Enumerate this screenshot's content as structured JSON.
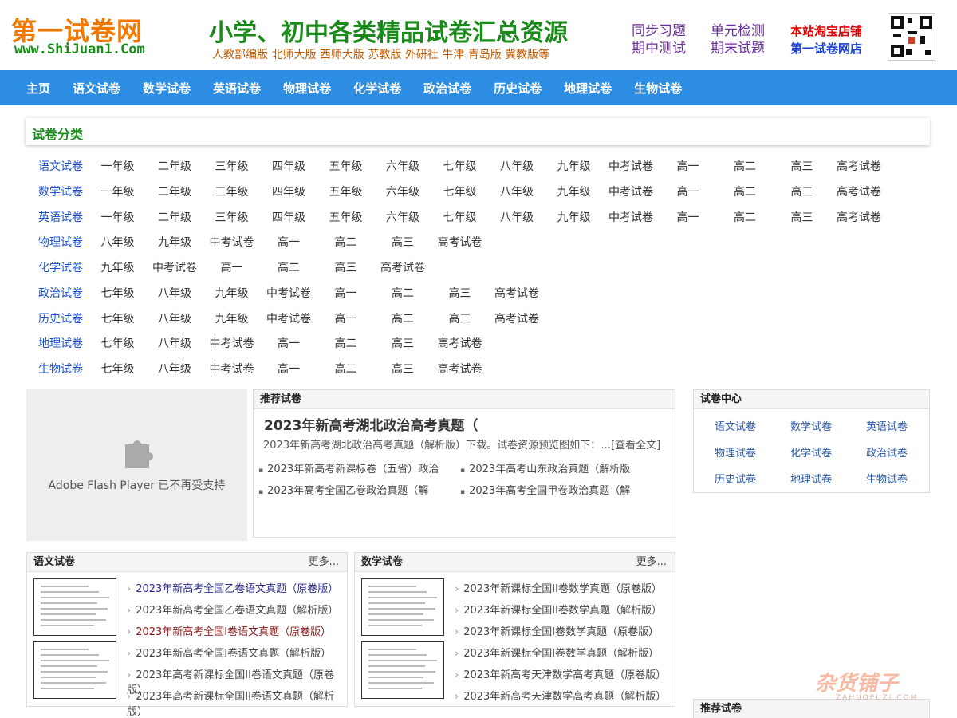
{
  "header": {
    "logo_cn": "第一试卷网",
    "logo_en": "www.ShiJuan1.Com",
    "slogan": "小学、初中各类精品试卷汇总资源",
    "editions": "人教部编版  北师大版  西师大版  苏教版  外研社  牛津  青岛版  冀教版等",
    "feature_1": "同步习题",
    "feature_2": "单元检测",
    "feature_3": "期中测试",
    "feature_4": "期末试题",
    "shop_1": "本站淘宝店铺",
    "shop_2": "第一试卷网店"
  },
  "nav": [
    "主页",
    "语文试卷",
    "数学试卷",
    "英语试卷",
    "物理试卷",
    "化学试卷",
    "政治试卷",
    "历史试卷",
    "地理试卷",
    "生物试卷"
  ],
  "category": {
    "title": "试卷分类",
    "rows": [
      [
        "语文试卷",
        "一年级",
        "二年级",
        "三年级",
        "四年级",
        "五年级",
        "六年级",
        "七年级",
        "八年级",
        "九年级",
        "中考试卷",
        "高一",
        "高二",
        "高三",
        "高考试卷"
      ],
      [
        "数学试卷",
        "一年级",
        "二年级",
        "三年级",
        "四年级",
        "五年级",
        "六年级",
        "七年级",
        "八年级",
        "九年级",
        "中考试卷",
        "高一",
        "高二",
        "高三",
        "高考试卷"
      ],
      [
        "英语试卷",
        "一年级",
        "二年级",
        "三年级",
        "四年级",
        "五年级",
        "六年级",
        "七年级",
        "八年级",
        "九年级",
        "中考试卷",
        "高一",
        "高二",
        "高三",
        "高考试卷"
      ],
      [
        "物理试卷",
        "八年级",
        "九年级",
        "中考试卷",
        "高一",
        "高二",
        "高三",
        "高考试卷"
      ],
      [
        "化学试卷",
        "九年级",
        "中考试卷",
        "高一",
        "高二",
        "高三",
        "高考试卷"
      ],
      [
        "政治试卷",
        "七年级",
        "八年级",
        "九年级",
        "中考试卷",
        "高一",
        "高二",
        "高三",
        "高考试卷"
      ],
      [
        "历史试卷",
        "七年级",
        "八年级",
        "九年级",
        "中考试卷",
        "高一",
        "高二",
        "高三",
        "高考试卷"
      ],
      [
        "地理试卷",
        "七年级",
        "八年级",
        "中考试卷",
        "高一",
        "高二",
        "高三",
        "高考试卷"
      ],
      [
        "生物试卷",
        "七年级",
        "八年级",
        "中考试卷",
        "高一",
        "高二",
        "高三",
        "高考试卷"
      ]
    ]
  },
  "flash": {
    "message": "Adobe Flash Player 已不再受支持"
  },
  "recommended": {
    "header": "推荐试卷",
    "title": "2023年新高考湖北政治高考真题（",
    "desc": "2023年新高考湖北政治高考真题（解析版）下载。试卷资源预览图如下：…[查看全文]",
    "links": [
      "2023年新高考新课标卷（五省）政治",
      "2023年高考山东政治真题（解析版",
      "2023年高考全国乙卷政治真题（解",
      "2023年高考全国甲卷政治真题（解"
    ]
  },
  "center": {
    "header": "试卷中心",
    "items": [
      "语文试卷",
      "数学试卷",
      "英语试卷",
      "物理试卷",
      "化学试卷",
      "政治试卷",
      "历史试卷",
      "地理试卷",
      "生物试卷"
    ]
  },
  "chinese_box": {
    "header": "语文试卷",
    "more": "更多...",
    "items": [
      "2023年新高考全国乙卷语文真题（原卷版）",
      "2023年新高考全国乙卷语文真题（解析版）",
      "2023年新高考全国I卷语文真题（原卷版）",
      "2023年新高考全国I卷语文真题（解析版）",
      "2023年高考新课标全国II卷语文真题（原卷版）",
      "2023年高考新课标全国II卷语文真题（解析版）"
    ]
  },
  "math_box": {
    "header": "数学试卷",
    "more": "更多...",
    "items": [
      "2023年新课标全国II卷数学真题（原卷版）",
      "2023年新课标全国II卷数学真题（解析版）",
      "2023年新课标全国I卷数学真题（原卷版）",
      "2023年新课标全国I卷数学真题（解析版）",
      "2023年新高考天津数学高考真题（原卷版）",
      "2023年新高考天津数学高考真题（解析版）"
    ]
  },
  "right_bottom": {
    "header": "推荐试卷"
  },
  "watermark": {
    "big": "杂货铺子",
    "small": "ZAHUOPUZI.COM"
  },
  "colors": {
    "nav_bg": "#2d8de2",
    "brand_green": "#1a8a1a",
    "logo_orange": "#f07800"
  }
}
